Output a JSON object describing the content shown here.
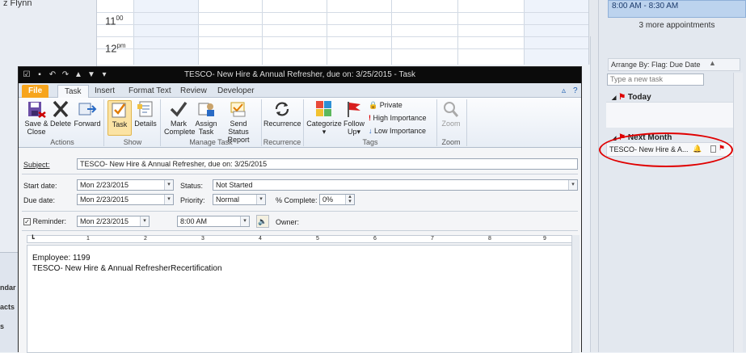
{
  "background": {
    "left_user": "z Flynn",
    "left_nav": [
      "ndar",
      "acts",
      "s"
    ],
    "hours": [
      {
        "h": "11",
        "ap": "00"
      },
      {
        "h": "12",
        "ap": "pm"
      }
    ],
    "appointment": "8:00 AM - 8:30 AM",
    "more_appointments": "3 more appointments",
    "arrange_by": "Arrange By: Flag: Due Date",
    "new_task_placeholder": "Type a new task",
    "group_today": "Today",
    "group_next_month": "Next Month",
    "task_item": "TESCO- New Hire & A..."
  },
  "window": {
    "title": "TESCO- New Hire &  Annual Refresher, due on: 3/25/2015  -  Task"
  },
  "tabs": [
    "File",
    "Task",
    "Insert",
    "Format Text",
    "Review",
    "Developer"
  ],
  "ribbon": {
    "save_close": [
      "Save &",
      "Close"
    ],
    "delete": "Delete",
    "forward": "Forward",
    "task": "Task",
    "details": "Details",
    "mark_complete": [
      "Mark",
      "Complete"
    ],
    "assign_task": [
      "Assign",
      "Task"
    ],
    "send_status": [
      "Send Status",
      "Report"
    ],
    "recurrence": "Recurrence",
    "categorize": "Categorize",
    "follow_up": [
      "Follow",
      "Up"
    ],
    "private": "Private",
    "high_importance": "High Importance",
    "low_importance": "Low Importance",
    "zoom": "Zoom",
    "groups": [
      "Actions",
      "Show",
      "Manage Task",
      "Recurrence",
      "Tags",
      "Zoom"
    ]
  },
  "form": {
    "subject_label": "Subject:",
    "subject_value": "TESCO- New Hire &  Annual Refresher, due on: 3/25/2015",
    "start_label": "Start date:",
    "start_value": "Mon 2/23/2015",
    "due_label": "Due date:",
    "due_value": "Mon 2/23/2015",
    "status_label": "Status:",
    "status_value": "Not Started",
    "priority_label": "Priority:",
    "priority_value": "Normal",
    "complete_label": "% Complete:",
    "complete_value": "0%",
    "reminder_label": "Reminder:",
    "reminder_date": "Mon 2/23/2015",
    "reminder_time": "8:00 AM",
    "owner_label": "Owner:",
    "ruler_marks": [
      "1",
      "2",
      "3",
      "4",
      "5",
      "6",
      "7",
      "8",
      "9"
    ],
    "body_lines": [
      "Employee: 1199",
      "TESCO- New Hire &  Annual RefresherRecertification"
    ]
  }
}
